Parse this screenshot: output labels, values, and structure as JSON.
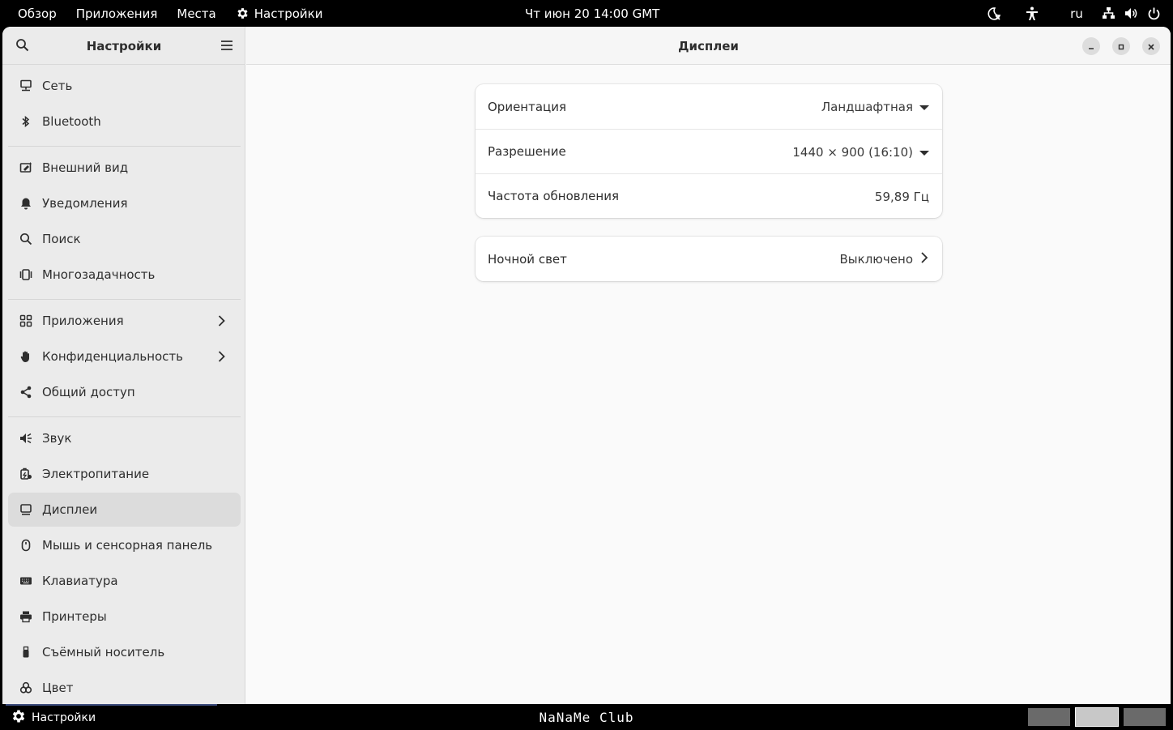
{
  "topbar": {
    "overview": "Обзор",
    "applications": "Приложения",
    "places": "Места",
    "app_name": "Настройки",
    "clock": "Чт июн 20  14:00 GMT",
    "keyboard_layout": "ru"
  },
  "sidebar": {
    "title": "Настройки",
    "groups": [
      [
        {
          "label": "Сеть",
          "icon": "network-icon"
        },
        {
          "label": "Bluetooth",
          "icon": "bluetooth-icon"
        }
      ],
      [
        {
          "label": "Внешний вид",
          "icon": "appearance-icon"
        },
        {
          "label": "Уведомления",
          "icon": "bell-icon"
        },
        {
          "label": "Поиск",
          "icon": "search-icon"
        },
        {
          "label": "Многозадачность",
          "icon": "multitasking-icon"
        }
      ],
      [
        {
          "label": "Приложения",
          "icon": "apps-grid-icon",
          "chevron": true
        },
        {
          "label": "Конфиденциальность",
          "icon": "hand-icon",
          "chevron": true
        },
        {
          "label": "Общий доступ",
          "icon": "share-icon"
        }
      ],
      [
        {
          "label": "Звук",
          "icon": "speaker-icon"
        },
        {
          "label": "Электропитание",
          "icon": "power-icon"
        },
        {
          "label": "Дисплеи",
          "icon": "display-icon",
          "active": true
        },
        {
          "label": "Мышь и сенсорная панель",
          "icon": "mouse-icon"
        },
        {
          "label": "Клавиатура",
          "icon": "keyboard-icon"
        },
        {
          "label": "Принтеры",
          "icon": "printer-icon"
        },
        {
          "label": "Съёмный носитель",
          "icon": "usb-icon"
        },
        {
          "label": "Цвет",
          "icon": "color-icon"
        }
      ]
    ]
  },
  "main": {
    "title": "Дисплеи",
    "display_card": {
      "orientation": {
        "label": "Ориентация",
        "value": "Ландшафтная"
      },
      "resolution": {
        "label": "Разрешение",
        "value": "1440 × 900 (16:10)"
      },
      "refresh_rate": {
        "label": "Частота обновления",
        "value": "59,89 Гц"
      }
    },
    "night_light": {
      "label": "Ночной свет",
      "value": "Выключено"
    }
  },
  "bottombar": {
    "task_label": "Настройки",
    "brand": "NaNaMe Club"
  },
  "colors": {
    "sidebar_bg": "#ebebeb",
    "active_item_bg": "#dcdcdc",
    "window_bg": "#fafafa",
    "card_bg": "#ffffff",
    "panel_bg": "#000000"
  }
}
